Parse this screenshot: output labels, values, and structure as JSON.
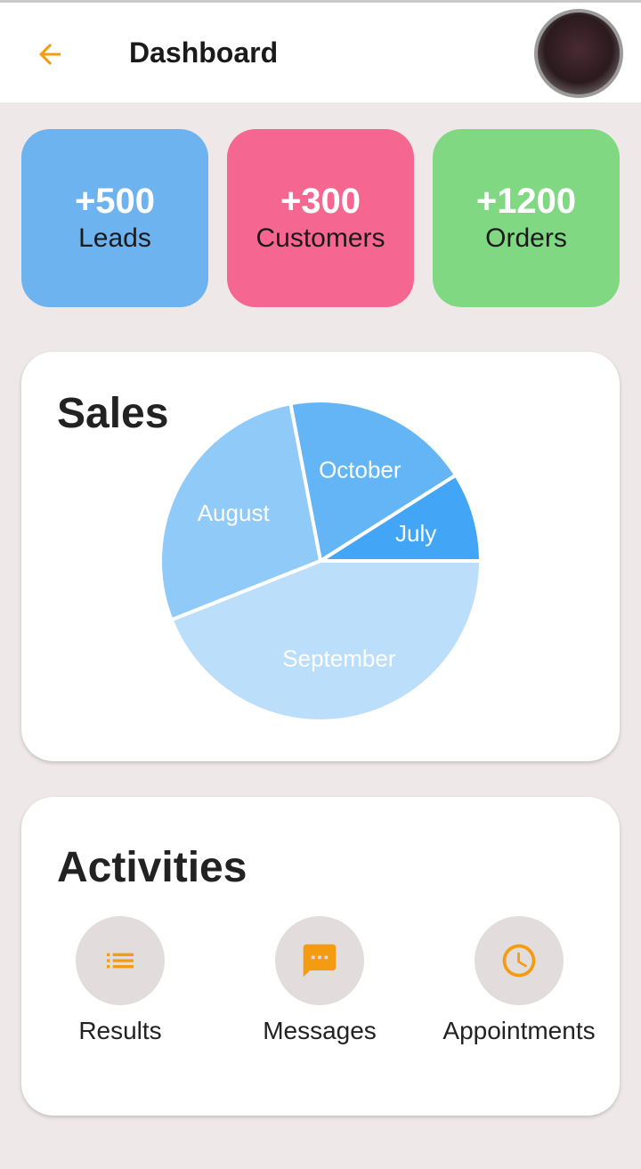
{
  "header": {
    "title": "Dashboard",
    "back_icon": "arrow-left-icon",
    "avatar_icon": "user-avatar"
  },
  "colors": {
    "accent": "#f39c12",
    "background": "#efe8e8",
    "leads": "#6db3f0",
    "customers": "#f56791",
    "orders": "#81d882"
  },
  "stats": [
    {
      "value": "+500",
      "label": "Leads"
    },
    {
      "value": "+300",
      "label": "Customers"
    },
    {
      "value": "+1200",
      "label": "Orders"
    }
  ],
  "sales": {
    "title": "Sales"
  },
  "chart_data": {
    "type": "pie",
    "title": "Sales",
    "categories": [
      "July",
      "October",
      "August",
      "September"
    ],
    "values": [
      9,
      19,
      28,
      44
    ],
    "colors": [
      "#42a5f5",
      "#64b5f6",
      "#90caf9",
      "#bbdefb"
    ]
  },
  "activities": {
    "title": "Activities",
    "items": [
      {
        "label": "Results",
        "icon": "list-icon"
      },
      {
        "label": "Messages",
        "icon": "message-icon"
      },
      {
        "label": "Appointments",
        "icon": "clock-icon"
      }
    ]
  }
}
